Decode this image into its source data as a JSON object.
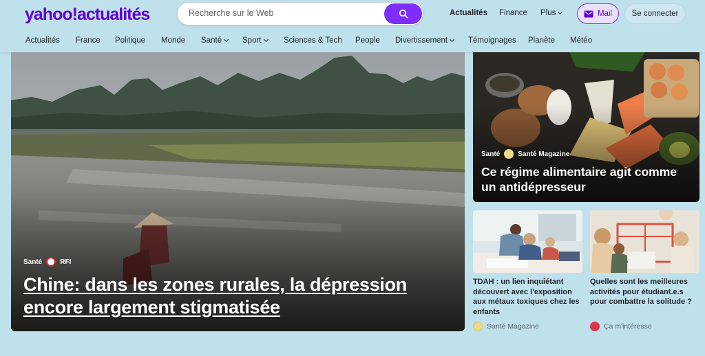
{
  "header": {
    "logo": "yahoo!actualités",
    "search_placeholder": "Recherche sur le Web",
    "top_links": [
      "Actualités",
      "Finance",
      "Plus"
    ],
    "mail_label": "Mail",
    "login_label": "Se connecter"
  },
  "nav": {
    "items": [
      "Actualités",
      "France",
      "Politique",
      "Monde",
      "Santé",
      "Sport",
      "Sciences & Tech",
      "People",
      "Divertissement",
      "Témoignages",
      "Planète",
      "Météo"
    ]
  },
  "hero": {
    "category": "Santé",
    "source": "RFI",
    "title": "Chine: dans les zones rurales, la dépression encore largement stigmatisée"
  },
  "side_card": {
    "category": "Santé",
    "source": "Santé Magazine",
    "title": "Ce régime alimentaire agit comme un antidépresseur"
  },
  "small_cards": [
    {
      "title": "TDAH : un lien inquiétant découvert avec l'exposition aux métaux toxiques chez les enfants",
      "source": "Santé Magazine"
    },
    {
      "title": "Quelles sont les meilleures activités pour étudiant.e.s pour combattre la solitude ?",
      "source": "Ça m'intéresse"
    }
  ],
  "colors": {
    "brand": "#6001d2",
    "accent": "#7d2eff",
    "background": "#bfe1ec"
  }
}
